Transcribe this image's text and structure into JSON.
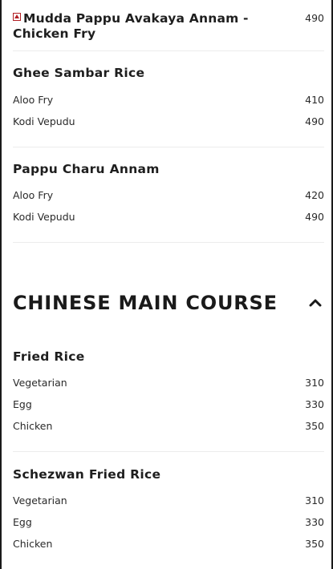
{
  "top_item": {
    "name": "Mudda Pappu Avakaya Annam - Chicken Fry",
    "price": "490"
  },
  "groups_a": [
    {
      "title": "Ghee Sambar Rice",
      "items": [
        {
          "name": "Aloo Fry",
          "price": "410"
        },
        {
          "name": "Kodi Vepudu",
          "price": "490"
        }
      ]
    },
    {
      "title": "Pappu Charu Annam",
      "items": [
        {
          "name": "Aloo Fry",
          "price": "420"
        },
        {
          "name": "Kodi Vepudu",
          "price": "490"
        }
      ]
    }
  ],
  "section": {
    "title": "CHINESE MAIN COURSE",
    "toggle_icon": "chevron-up-icon"
  },
  "groups_b": [
    {
      "title": "Fried Rice",
      "items": [
        {
          "name": "Vegetarian",
          "price": "310"
        },
        {
          "name": "Egg",
          "price": "330"
        },
        {
          "name": "Chicken",
          "price": "350"
        }
      ]
    },
    {
      "title": "Schezwan Fried Rice",
      "items": [
        {
          "name": "Vegetarian",
          "price": "310"
        },
        {
          "name": "Egg",
          "price": "330"
        },
        {
          "name": "Chicken",
          "price": "350"
        }
      ]
    }
  ],
  "colors": {
    "nonveg_marker": "#b21f24",
    "text": "#1e1e1e",
    "divider": "#ececec"
  }
}
